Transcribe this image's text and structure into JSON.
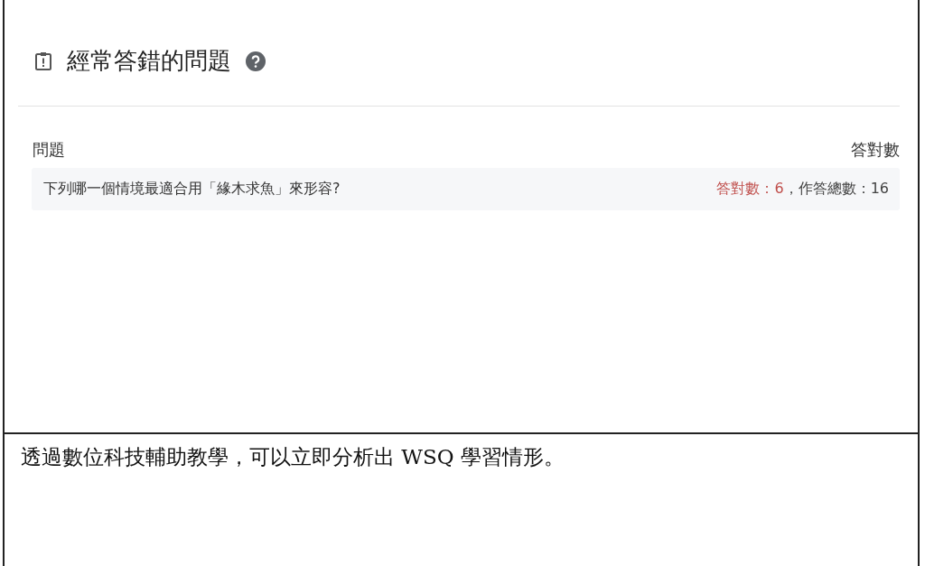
{
  "panel": {
    "title": "經常答錯的問題",
    "columns": [
      {
        "label": "問題"
      },
      {
        "label": "答對數"
      }
    ],
    "rows": [
      {
        "question": "下列哪一個情境最適合用「緣木求魚」來形容?",
        "correct": "答對數：6",
        "total": "，作答總數：16"
      }
    ]
  },
  "caption": "透過數位科技輔助教學，可以立即分析出 WSQ 學習情形。"
}
